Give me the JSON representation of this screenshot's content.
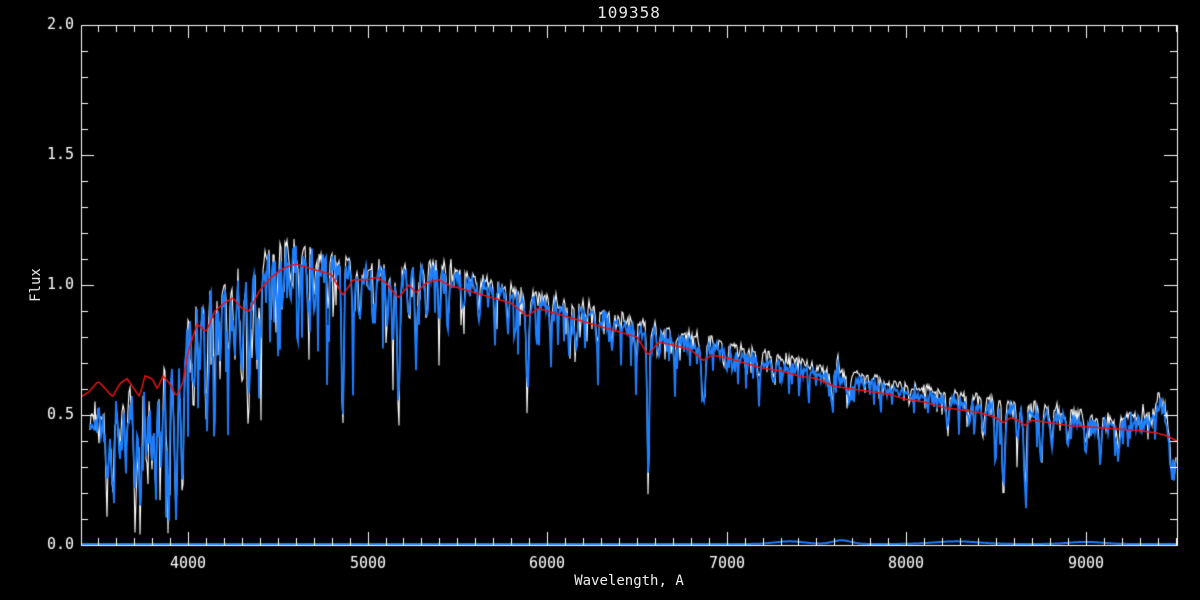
{
  "window": {
    "background": "#000000"
  },
  "chart_data": {
    "type": "line",
    "title": "109358",
    "xlabel": "Wavelength, A",
    "ylabel": "Flux",
    "xlim": [
      3404,
      9508
    ],
    "ylim": [
      0.0,
      2.0
    ],
    "grid": false,
    "legend": "none",
    "x_ticks": [
      {
        "value": 4000,
        "label": "4000"
      },
      {
        "value": 5000,
        "label": "5000"
      },
      {
        "value": 6000,
        "label": "6000"
      },
      {
        "value": 7000,
        "label": "7000"
      },
      {
        "value": 8000,
        "label": "8000"
      },
      {
        "value": 9000,
        "label": "9000"
      }
    ],
    "x_minor_step": 100,
    "y_ticks": [
      {
        "value": 0.0,
        "label": "0.0"
      },
      {
        "value": 0.5,
        "label": "0.5"
      },
      {
        "value": 1.0,
        "label": "1.0"
      },
      {
        "value": 1.5,
        "label": "1.5"
      },
      {
        "value": 2.0,
        "label": "2.0"
      }
    ],
    "y_minor_step": 0.1,
    "colors": {
      "background": "#000000",
      "axis": "#ffffff",
      "spectrum_blue": "#1d7fff",
      "spectrum_white": "#ffffff",
      "model_red": "#ee1111",
      "title_text": "#e6e6e6"
    },
    "series": [
      {
        "name": "observed-spectrum-white",
        "color": "#ffffff",
        "role": "noisy spectrum drawn behind, sits ~0.03 flux above blue",
        "offset": 0.03,
        "noise_scale": 0.9,
        "spike_scale": 0.8,
        "line_scale": 1.1,
        "seed": 1337,
        "range": [
          3455,
          9505
        ]
      },
      {
        "name": "observed-spectrum-blue",
        "color": "#1d7fff",
        "role": "main noisy spectrum",
        "offset": 0.0,
        "noise_scale": 1.0,
        "spike_scale": 1.0,
        "line_scale": 1.0,
        "seed": 42,
        "range": [
          3455,
          9505
        ]
      },
      {
        "name": "model-red",
        "color": "#ee1111",
        "role": "smooth fitted model drawn on top",
        "points": [
          [
            3404,
            0.57
          ],
          [
            3450,
            0.59
          ],
          [
            3500,
            0.63
          ],
          [
            3540,
            0.6
          ],
          [
            3580,
            0.57
          ],
          [
            3620,
            0.62
          ],
          [
            3660,
            0.64
          ],
          [
            3700,
            0.6
          ],
          [
            3730,
            0.57
          ],
          [
            3760,
            0.65
          ],
          [
            3800,
            0.64
          ],
          [
            3830,
            0.6
          ],
          [
            3860,
            0.65
          ],
          [
            3900,
            0.62
          ],
          [
            3933,
            0.57
          ],
          [
            3970,
            0.62
          ],
          [
            4000,
            0.74
          ],
          [
            4050,
            0.85
          ],
          [
            4101,
            0.82
          ],
          [
            4150,
            0.9
          ],
          [
            4200,
            0.93
          ],
          [
            4250,
            0.95
          ],
          [
            4300,
            0.91
          ],
          [
            4340,
            0.9
          ],
          [
            4400,
            0.98
          ],
          [
            4450,
            1.02
          ],
          [
            4500,
            1.05
          ],
          [
            4550,
            1.07
          ],
          [
            4600,
            1.08
          ],
          [
            4650,
            1.07
          ],
          [
            4700,
            1.06
          ],
          [
            4750,
            1.05
          ],
          [
            4800,
            1.04
          ],
          [
            4861,
            0.96
          ],
          [
            4920,
            1.02
          ],
          [
            5000,
            1.02
          ],
          [
            5050,
            1.03
          ],
          [
            5100,
            1.01
          ],
          [
            5172,
            0.95
          ],
          [
            5230,
            1.0
          ],
          [
            5270,
            0.97
          ],
          [
            5330,
            1.01
          ],
          [
            5400,
            1.02
          ],
          [
            5450,
            1.0
          ],
          [
            5500,
            0.99
          ],
          [
            5600,
            0.97
          ],
          [
            5700,
            0.95
          ],
          [
            5800,
            0.93
          ],
          [
            5890,
            0.88
          ],
          [
            5950,
            0.91
          ],
          [
            6000,
            0.9
          ],
          [
            6100,
            0.88
          ],
          [
            6200,
            0.86
          ],
          [
            6300,
            0.84
          ],
          [
            6400,
            0.82
          ],
          [
            6500,
            0.8
          ],
          [
            6563,
            0.73
          ],
          [
            6620,
            0.78
          ],
          [
            6700,
            0.77
          ],
          [
            6800,
            0.75
          ],
          [
            6870,
            0.71
          ],
          [
            6920,
            0.73
          ],
          [
            7000,
            0.72
          ],
          [
            7100,
            0.7
          ],
          [
            7200,
            0.68
          ],
          [
            7300,
            0.67
          ],
          [
            7400,
            0.65
          ],
          [
            7500,
            0.64
          ],
          [
            7600,
            0.61
          ],
          [
            7700,
            0.6
          ],
          [
            7800,
            0.59
          ],
          [
            7900,
            0.58
          ],
          [
            8000,
            0.56
          ],
          [
            8100,
            0.55
          ],
          [
            8200,
            0.53
          ],
          [
            8300,
            0.52
          ],
          [
            8400,
            0.51
          ],
          [
            8450,
            0.5
          ],
          [
            8500,
            0.49
          ],
          [
            8542,
            0.47
          ],
          [
            8580,
            0.49
          ],
          [
            8620,
            0.48
          ],
          [
            8662,
            0.46
          ],
          [
            8700,
            0.48
          ],
          [
            8800,
            0.47
          ],
          [
            8900,
            0.46
          ],
          [
            9000,
            0.455
          ],
          [
            9100,
            0.45
          ],
          [
            9200,
            0.445
          ],
          [
            9300,
            0.44
          ],
          [
            9400,
            0.43
          ],
          [
            9450,
            0.42
          ],
          [
            9508,
            0.4
          ]
        ]
      }
    ],
    "continuum_points": [
      [
        3455,
        0.46
      ],
      [
        3500,
        0.5
      ],
      [
        3550,
        0.47
      ],
      [
        3600,
        0.52
      ],
      [
        3650,
        0.55
      ],
      [
        3700,
        0.56
      ],
      [
        3750,
        0.6
      ],
      [
        3800,
        0.62
      ],
      [
        3850,
        0.64
      ],
      [
        3900,
        0.66
      ],
      [
        3950,
        0.7
      ],
      [
        4000,
        0.8
      ],
      [
        4050,
        0.88
      ],
      [
        4100,
        0.92
      ],
      [
        4150,
        0.95
      ],
      [
        4200,
        0.96
      ],
      [
        4250,
        0.98
      ],
      [
        4300,
        0.97
      ],
      [
        4350,
        1.0
      ],
      [
        4400,
        1.05
      ],
      [
        4450,
        1.09
      ],
      [
        4500,
        1.12
      ],
      [
        4550,
        1.13
      ],
      [
        4600,
        1.12
      ],
      [
        4650,
        1.1
      ],
      [
        4700,
        1.09
      ],
      [
        4800,
        1.07
      ],
      [
        4900,
        1.05
      ],
      [
        5000,
        1.03
      ],
      [
        5100,
        1.04
      ],
      [
        5200,
        1.03
      ],
      [
        5300,
        1.04
      ],
      [
        5400,
        1.05
      ],
      [
        5500,
        1.02
      ],
      [
        5600,
        1.0
      ],
      [
        5700,
        0.98
      ],
      [
        5800,
        0.96
      ],
      [
        5900,
        0.94
      ],
      [
        6000,
        0.92
      ],
      [
        6100,
        0.9
      ],
      [
        6200,
        0.89
      ],
      [
        6300,
        0.87
      ],
      [
        6400,
        0.85
      ],
      [
        6500,
        0.83
      ],
      [
        6600,
        0.81
      ],
      [
        6700,
        0.79
      ],
      [
        6800,
        0.78
      ],
      [
        6900,
        0.76
      ],
      [
        7000,
        0.74
      ],
      [
        7100,
        0.72
      ],
      [
        7200,
        0.71
      ],
      [
        7300,
        0.69
      ],
      [
        7400,
        0.68
      ],
      [
        7500,
        0.66
      ],
      [
        7600,
        0.64
      ],
      [
        7700,
        0.63
      ],
      [
        7800,
        0.62
      ],
      [
        7900,
        0.6
      ],
      [
        8000,
        0.58
      ],
      [
        8100,
        0.57
      ],
      [
        8200,
        0.56
      ],
      [
        8300,
        0.55
      ],
      [
        8400,
        0.54
      ],
      [
        8500,
        0.53
      ],
      [
        8600,
        0.52
      ],
      [
        8700,
        0.51
      ],
      [
        8800,
        0.5
      ],
      [
        8900,
        0.48
      ],
      [
        9000,
        0.47
      ],
      [
        9100,
        0.46
      ],
      [
        9200,
        0.46
      ],
      [
        9300,
        0.47
      ],
      [
        9400,
        0.48
      ],
      [
        9450,
        0.45
      ],
      [
        9505,
        0.37
      ]
    ],
    "absorption_lines": [
      [
        3550,
        0.22,
        9
      ],
      [
        3581,
        0.3,
        8
      ],
      [
        3620,
        0.2,
        7
      ],
      [
        3655,
        0.22,
        7
      ],
      [
        3705,
        0.32,
        8
      ],
      [
        3735,
        0.4,
        8
      ],
      [
        3770,
        0.3,
        7
      ],
      [
        3798,
        0.34,
        7
      ],
      [
        3820,
        0.38,
        7
      ],
      [
        3850,
        0.34,
        7
      ],
      [
        3890,
        0.42,
        8
      ],
      [
        3933,
        0.55,
        8
      ],
      [
        3968,
        0.5,
        8
      ],
      [
        4030,
        0.28,
        7
      ],
      [
        4063,
        0.2,
        6
      ],
      [
        4101,
        0.4,
        7
      ],
      [
        4144,
        0.22,
        6
      ],
      [
        4180,
        0.18,
        6
      ],
      [
        4227,
        0.28,
        6
      ],
      [
        4260,
        0.22,
        6
      ],
      [
        4300,
        0.35,
        8
      ],
      [
        4340,
        0.42,
        7
      ],
      [
        4383,
        0.3,
        6
      ],
      [
        4405,
        0.26,
        6
      ],
      [
        4460,
        0.18,
        6
      ],
      [
        4494,
        0.2,
        6
      ],
      [
        4530,
        0.22,
        6
      ],
      [
        4570,
        0.16,
        6
      ],
      [
        4620,
        0.15,
        6
      ],
      [
        4668,
        0.2,
        6
      ],
      [
        4704,
        0.15,
        6
      ],
      [
        4780,
        0.16,
        6
      ],
      [
        4861,
        0.58,
        6
      ],
      [
        4920,
        0.22,
        6
      ],
      [
        4957,
        0.2,
        6
      ],
      [
        5040,
        0.18,
        6
      ],
      [
        5110,
        0.2,
        6
      ],
      [
        5140,
        0.25,
        6
      ],
      [
        5172,
        0.5,
        7
      ],
      [
        5230,
        0.18,
        6
      ],
      [
        5270,
        0.28,
        7
      ],
      [
        5328,
        0.2,
        6
      ],
      [
        5400,
        0.18,
        6
      ],
      [
        5446,
        0.2,
        6
      ],
      [
        5530,
        0.14,
        6
      ],
      [
        5620,
        0.12,
        6
      ],
      [
        5710,
        0.13,
        6
      ],
      [
        5782,
        0.12,
        6
      ],
      [
        5890,
        0.3,
        8
      ],
      [
        6020,
        0.12,
        6
      ],
      [
        6122,
        0.14,
        6
      ],
      [
        6162,
        0.14,
        6
      ],
      [
        6280,
        0.12,
        7
      ],
      [
        6360,
        0.1,
        6
      ],
      [
        6495,
        0.14,
        6
      ],
      [
        6563,
        0.52,
        6
      ],
      [
        6620,
        0.1,
        6
      ],
      [
        6710,
        0.1,
        6
      ],
      [
        6870,
        0.22,
        10
      ],
      [
        7000,
        0.08,
        7
      ],
      [
        7180,
        0.1,
        8
      ],
      [
        7260,
        0.08,
        8
      ],
      [
        7594,
        0.14,
        10
      ],
      [
        7680,
        0.08,
        8
      ],
      [
        8230,
        0.1,
        8
      ],
      [
        8350,
        0.08,
        7
      ],
      [
        8430,
        0.1,
        7
      ],
      [
        8498,
        0.18,
        6
      ],
      [
        8542,
        0.32,
        7
      ],
      [
        8620,
        0.12,
        6
      ],
      [
        8662,
        0.3,
        7
      ],
      [
        8750,
        0.18,
        7
      ],
      [
        8810,
        0.12,
        7
      ],
      [
        8900,
        0.1,
        7
      ],
      [
        9000,
        0.1,
        8
      ],
      [
        9080,
        0.12,
        8
      ],
      [
        9180,
        0.1,
        8
      ],
      [
        9480,
        0.14,
        12
      ]
    ],
    "emission_features": [
      [
        7600,
        0.14,
        5
      ],
      [
        7617,
        0.07,
        4
      ],
      [
        9420,
        0.06,
        20
      ]
    ],
    "noise_amp_points": [
      [
        3455,
        0.085
      ],
      [
        3800,
        0.095
      ],
      [
        4000,
        0.1
      ],
      [
        4300,
        0.1
      ],
      [
        4600,
        0.09
      ],
      [
        4800,
        0.075
      ],
      [
        5000,
        0.055
      ],
      [
        5300,
        0.05
      ],
      [
        5600,
        0.045
      ],
      [
        6000,
        0.04
      ],
      [
        6500,
        0.034
      ],
      [
        7000,
        0.03
      ],
      [
        7500,
        0.027
      ],
      [
        8000,
        0.025
      ],
      [
        8500,
        0.028
      ],
      [
        8800,
        0.03
      ],
      [
        9100,
        0.045
      ],
      [
        9300,
        0.055
      ],
      [
        9505,
        0.065
      ]
    ],
    "spike_amp_points": [
      [
        3455,
        0.3
      ],
      [
        3800,
        0.4
      ],
      [
        4100,
        0.42
      ],
      [
        4400,
        0.4
      ],
      [
        4700,
        0.38
      ],
      [
        5000,
        0.3
      ],
      [
        5300,
        0.26
      ],
      [
        5600,
        0.22
      ],
      [
        5900,
        0.2
      ],
      [
        6200,
        0.17
      ],
      [
        6500,
        0.15
      ],
      [
        6900,
        0.13
      ],
      [
        7300,
        0.12
      ],
      [
        7700,
        0.11
      ],
      [
        8100,
        0.1
      ],
      [
        8400,
        0.16
      ],
      [
        8700,
        0.16
      ],
      [
        9000,
        0.1
      ],
      [
        9505,
        0.12
      ]
    ],
    "spike_probability": 0.35,
    "zero_line": {
      "color": "#1d7fff",
      "base_flux": 0.004,
      "range": [
        3404,
        9508
      ],
      "bumps": [
        [
          7350,
          0.01,
          80
        ],
        [
          7640,
          0.014,
          50
        ],
        [
          8280,
          0.01,
          120
        ],
        [
          9000,
          0.008,
          90
        ]
      ]
    }
  }
}
